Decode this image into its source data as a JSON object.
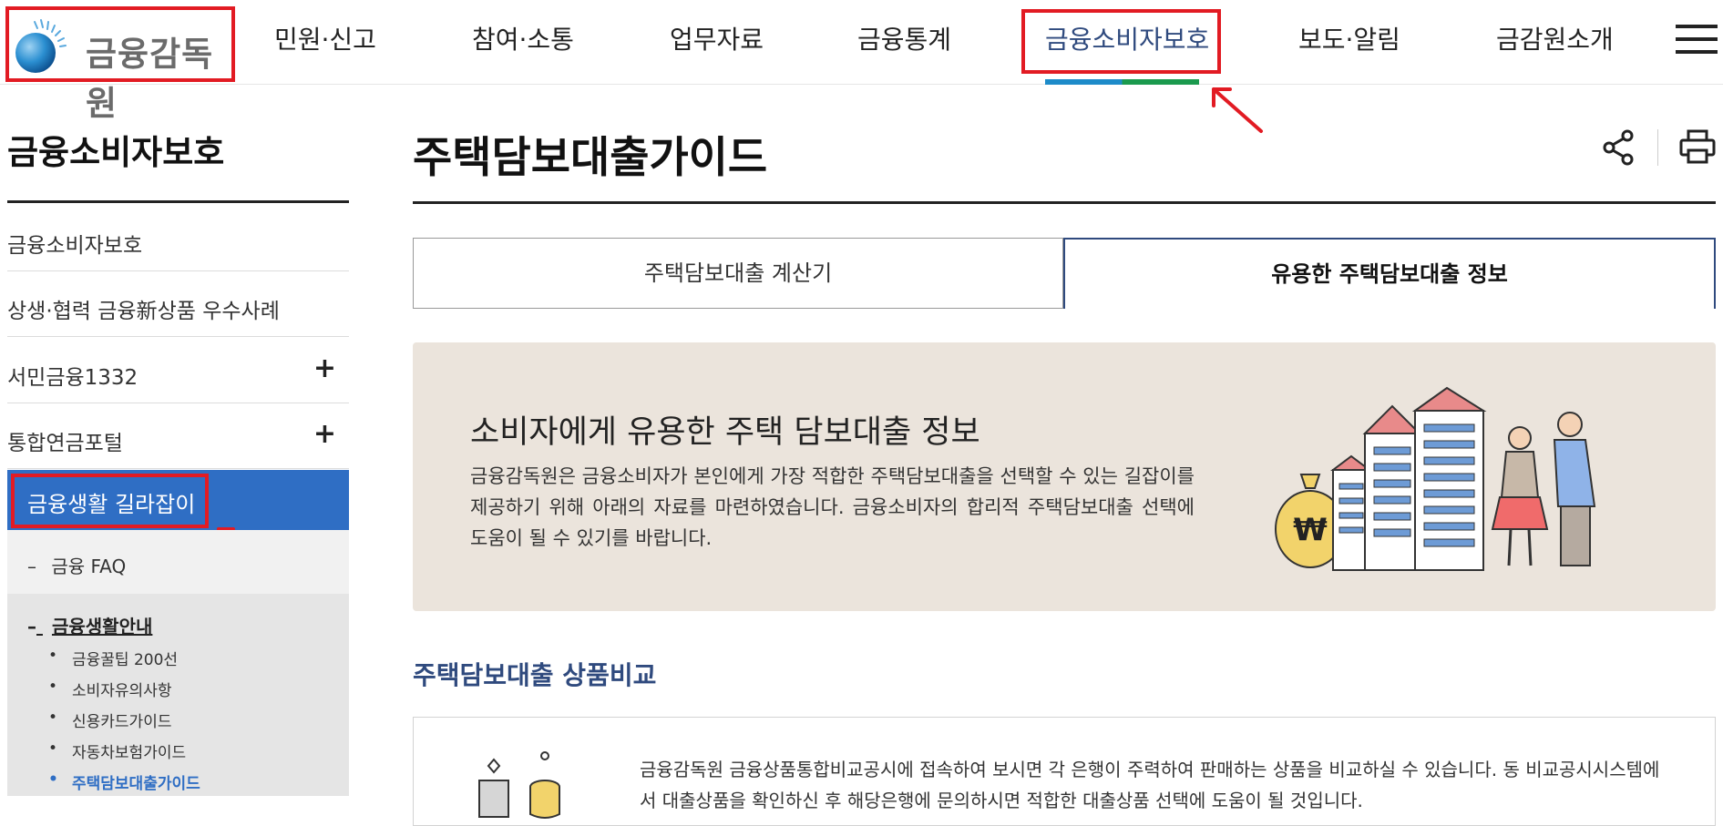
{
  "header": {
    "logo_text": "금융감독원",
    "nav": [
      {
        "label": "민원·신고"
      },
      {
        "label": "참여·소통"
      },
      {
        "label": "업무자료"
      },
      {
        "label": "금융통계"
      },
      {
        "label": "금융소비자보호",
        "active": true
      },
      {
        "label": "보도·알림"
      },
      {
        "label": "금감원소개"
      }
    ],
    "menu_icon": "hamburger-menu-icon",
    "accent_colors": {
      "blue": "#1d8bc9",
      "green": "#1b9a4e",
      "highlight": "#e21b23"
    }
  },
  "sidebar": {
    "title": "금융소비자보호",
    "items": [
      {
        "label": "금융소비자보호"
      },
      {
        "label": "상생·협력 금융新상품 우수사례"
      },
      {
        "label": "서민금융1332",
        "expand": "+"
      },
      {
        "label": "통합연금포털",
        "expand": "+"
      }
    ],
    "active": {
      "label": "금융생활 길라잡이"
    },
    "sub1": {
      "label": "금융 FAQ",
      "dash": "–"
    },
    "sub2": {
      "head": "금융생활안내",
      "dash": "–",
      "items": [
        {
          "label": "금융꿀팁 200선"
        },
        {
          "label": "소비자유의사항"
        },
        {
          "label": "신용카드가이드"
        },
        {
          "label": "자동차보험가이드"
        },
        {
          "label": "주택담보대출가이드",
          "current": true
        }
      ]
    },
    "active_color": "#2f6ec4"
  },
  "main": {
    "title": "주택담보대출가이드",
    "icons": [
      "share-icon",
      "print-icon"
    ],
    "tabs": [
      {
        "label": "주택담보대출 계산기"
      },
      {
        "label": "유용한 주택담보대출 정보",
        "selected": true
      }
    ],
    "banner": {
      "heading": "소비자에게 유용한 주택 담보대출 정보",
      "body": "금융감독원은 금융소비자가 본인에게 가장 적합한 주택담보대출을 선택할 수 있는 길잡이를 제공하기 위해 아래의 자료를 마련하였습니다. 금융소비자의 합리적 주택담보대출 선택에 도움이 될 수 있기를 바랍니다.",
      "currency_symbol": "₩"
    },
    "section_title": "주택담보대출 상품비교",
    "card_text": "금융감독원 금융상품통합비교공시에 접속하여 보시면 각 은행이 주력하여 판매하는 상품을 비교하실 수 있습니다. 동 비교공시시스템에서 대출상품을 확인하신 후 해당은행에 문의하시면 적합한 대출상품 선택에 도움이 될 것입니다."
  }
}
